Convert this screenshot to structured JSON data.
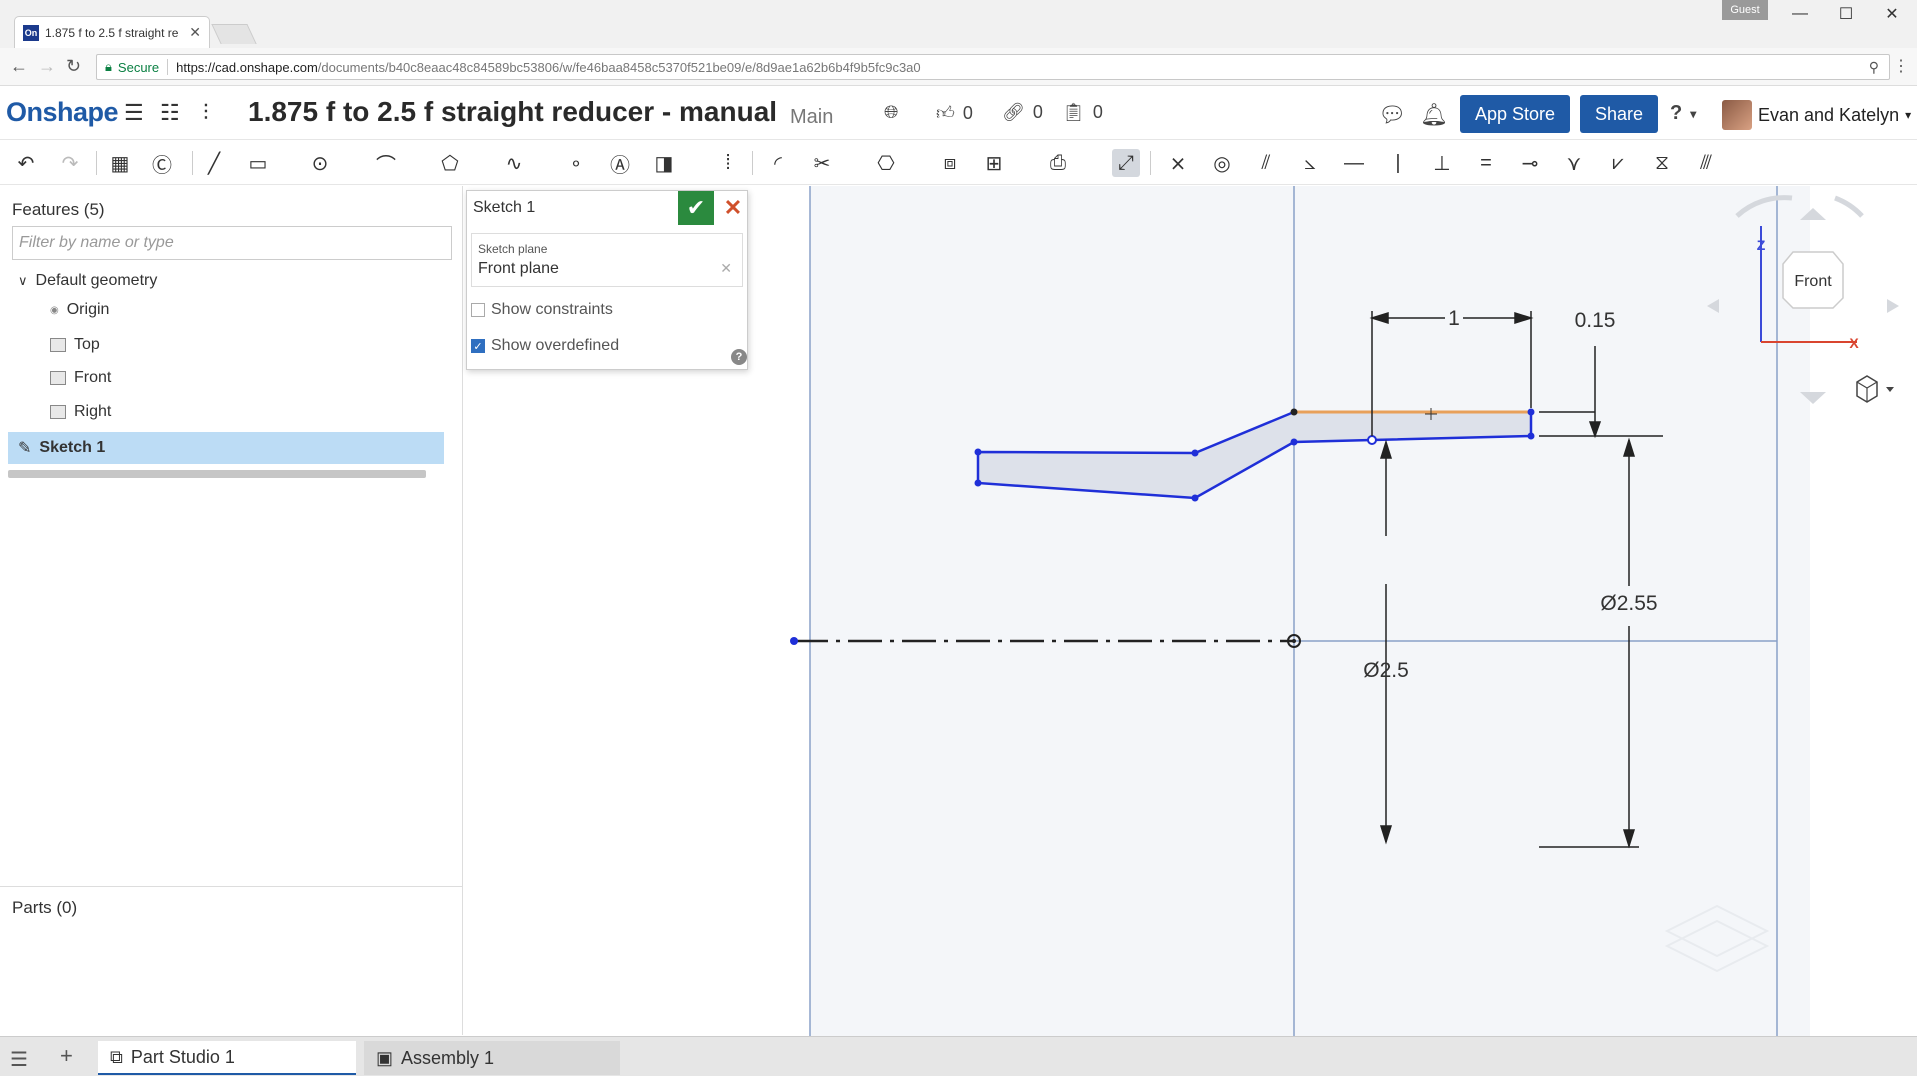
{
  "browser": {
    "tab_title": "1.875 f to 2.5 f straight re",
    "favicon_text": "On",
    "guest_label": "Guest",
    "secure_label": "Secure",
    "url_host": "https://cad.onshape.com",
    "url_path": "/documents/b40c8eaac48c84589bc53806/w/fe46baa8458c5370f521be09/e/8d9ae1a62b6b4f9b5fc9c3a0"
  },
  "app": {
    "logo": "Onshape",
    "document_title": "1.875 f to 2.5 f straight reducer - manual",
    "workspace": "Main",
    "likes": "0",
    "links": "0",
    "copies": "0",
    "app_store_label": "App Store",
    "share_label": "Share",
    "user_name": "Evan and Katelyn",
    "help_label": "?"
  },
  "features_panel": {
    "title": "Features (5)",
    "filter_placeholder": "Filter by name or type",
    "default_geometry": "Default geometry",
    "items": [
      {
        "label": "Origin"
      },
      {
        "label": "Top"
      },
      {
        "label": "Front"
      },
      {
        "label": "Right"
      }
    ],
    "selected_feature": "Sketch 1",
    "parts_title": "Parts (0)"
  },
  "sketch_dialog": {
    "title": "Sketch 1",
    "plane_label": "Sketch plane",
    "plane_value": "Front plane",
    "show_constraints": "Show constraints",
    "show_overdefined": "Show overdefined",
    "show_constraints_checked": false,
    "show_overdefined_checked": true
  },
  "canvas": {
    "dimensions": {
      "length": "1",
      "offset": "0.15",
      "diameter_inner": "Ø2.5",
      "diameter_outer": "Ø2.55"
    },
    "viewcube": {
      "face": "Front",
      "axis_z": "Z",
      "axis_x": "X"
    },
    "colors": {
      "sketch_line": "#1f2fd8",
      "selected_line": "#e8a05a",
      "fill": "#dde1ea"
    }
  },
  "bottom_tabs": [
    {
      "label": "Part Studio 1",
      "active": true
    },
    {
      "label": "Assembly 1",
      "active": false
    }
  ]
}
